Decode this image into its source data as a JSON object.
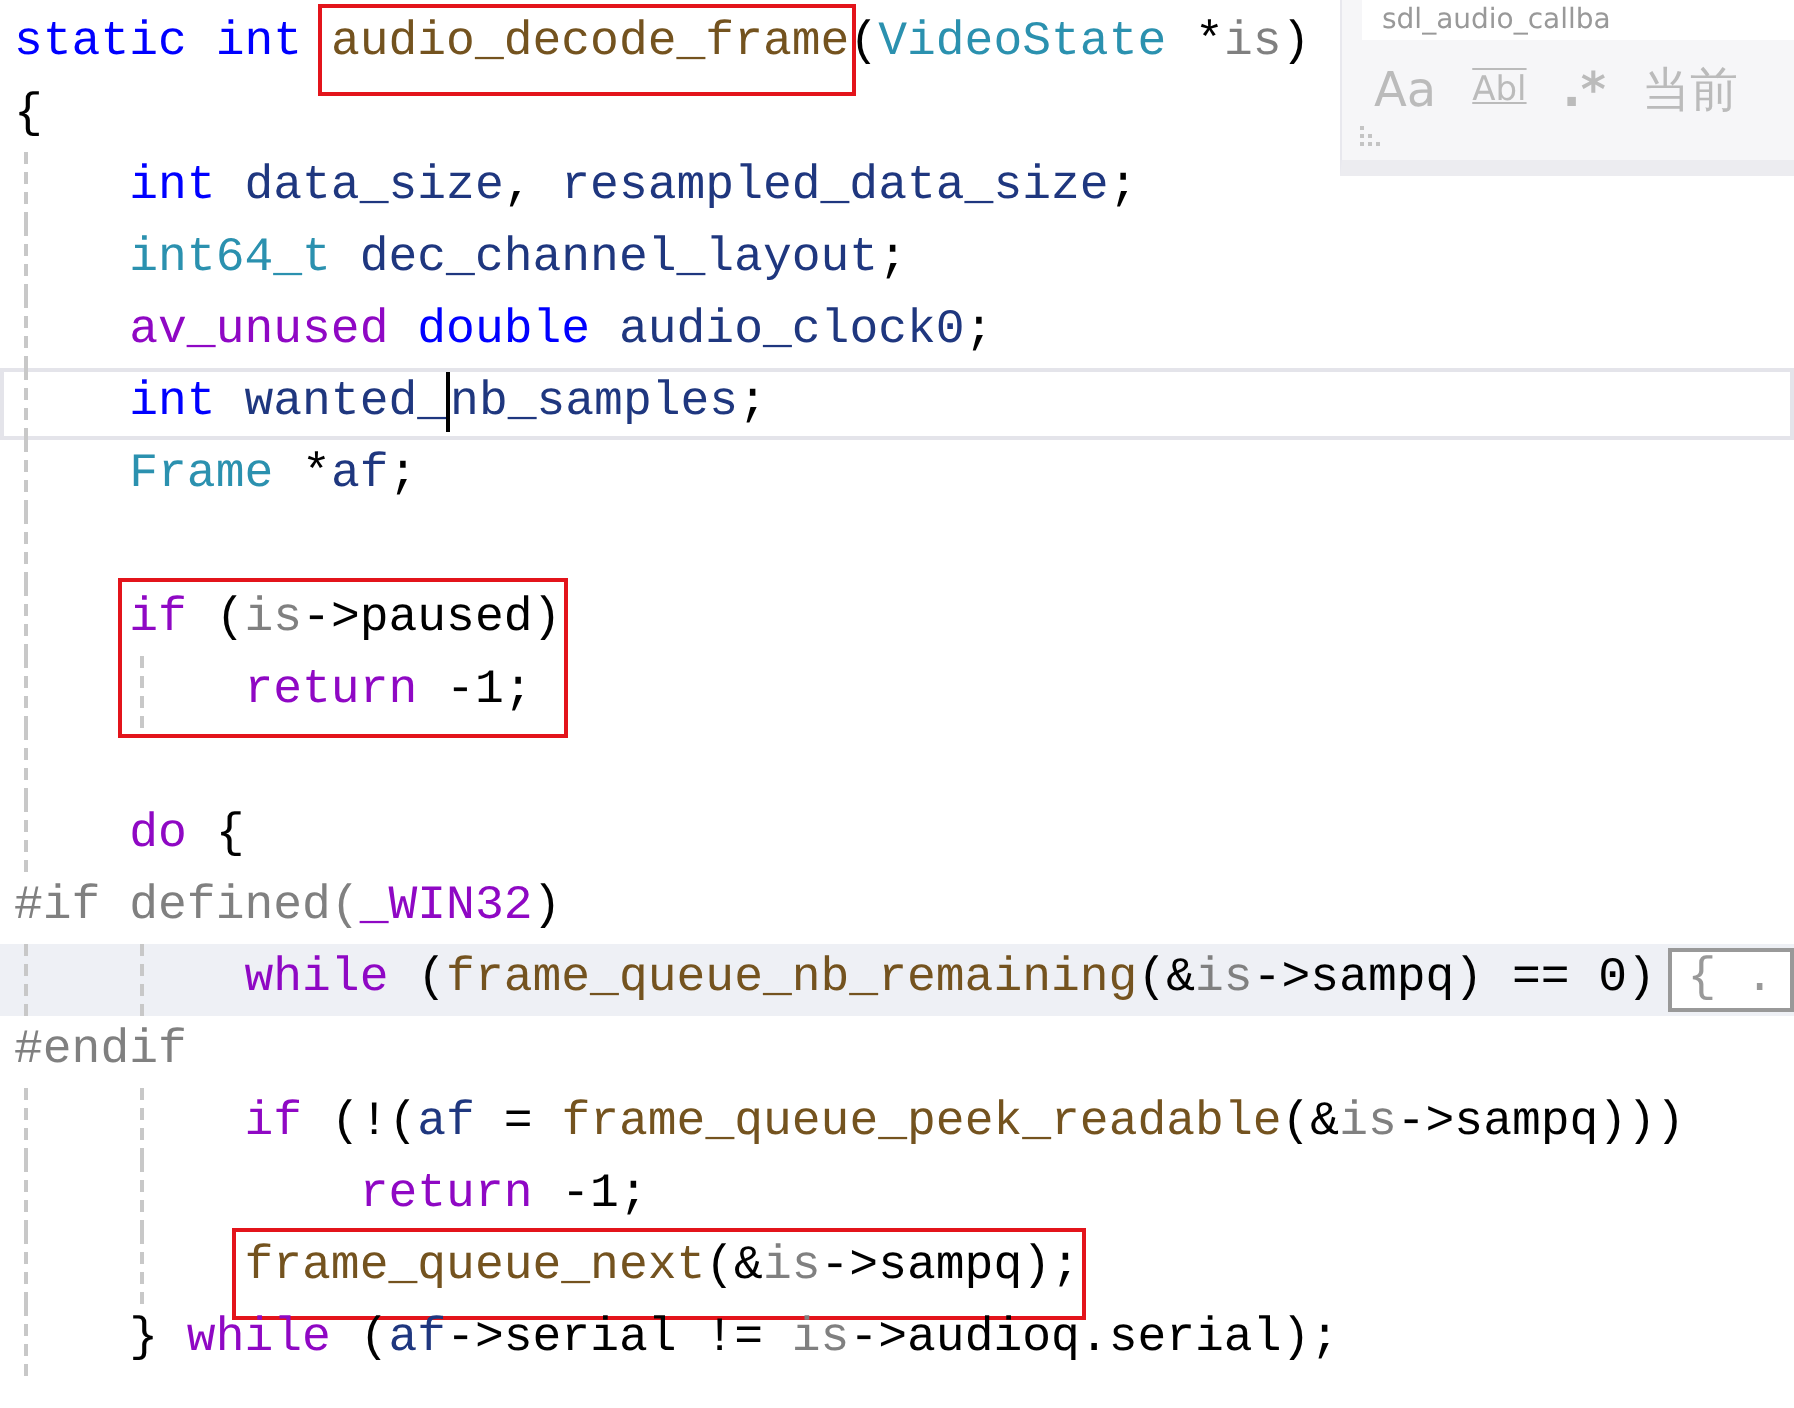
{
  "find_widget": {
    "search_value": "sdl_audio_callba",
    "options": [
      {
        "label": "Aa",
        "kind": "case",
        "selected": false
      },
      {
        "label": "Abl",
        "kind": "word",
        "selected": false
      },
      {
        "label": ".*",
        "kind": "regex",
        "selected": false
      },
      {
        "label": "当前",
        "kind": "scope",
        "selected": false
      }
    ]
  },
  "lines": [
    {
      "current": false,
      "highlighted": false,
      "tokens": [
        {
          "text": "static int ",
          "kind": "keyword"
        },
        {
          "kind": "box",
          "tokens": [
            {
              "text": "audio_decode_frame",
              "kind": "function"
            }
          ]
        },
        {
          "text": "(",
          "kind": "plain"
        },
        {
          "text": "VideoState",
          "kind": "type"
        },
        {
          "text": " *",
          "kind": "plain"
        },
        {
          "text": "is",
          "kind": "param"
        },
        {
          "text": ")",
          "kind": "plain"
        }
      ]
    },
    {
      "current": false,
      "highlighted": false,
      "tokens": [
        {
          "text": "{",
          "kind": "plain"
        }
      ]
    },
    {
      "current": false,
      "highlighted": false,
      "tokens": [
        {
          "text": "    int ",
          "kind": "keyword"
        },
        {
          "text": "data_size",
          "kind": "local"
        },
        {
          "text": ", ",
          "kind": "plain"
        },
        {
          "text": "resampled_data_size",
          "kind": "local"
        },
        {
          "text": ";",
          "kind": "plain"
        }
      ]
    },
    {
      "current": false,
      "highlighted": false,
      "tokens": [
        {
          "text": "    int64_t ",
          "kind": "type"
        },
        {
          "text": "dec_channel_layout",
          "kind": "local"
        },
        {
          "text": ";",
          "kind": "plain"
        }
      ]
    },
    {
      "current": false,
      "highlighted": false,
      "tokens": [
        {
          "text": "    av_unused ",
          "kind": "macro"
        },
        {
          "text": "double ",
          "kind": "keyword"
        },
        {
          "text": "audio_clock0",
          "kind": "local"
        },
        {
          "text": ";",
          "kind": "plain"
        }
      ]
    },
    {
      "current": true,
      "highlighted": false,
      "tokens": [
        {
          "text": "    int ",
          "kind": "keyword"
        },
        {
          "text": "wanted_",
          "kind": "local"
        },
        {
          "kind": "caret"
        },
        {
          "text": "nb_samples",
          "kind": "local"
        },
        {
          "text": ";",
          "kind": "plain"
        }
      ]
    },
    {
      "current": false,
      "highlighted": false,
      "tokens": [
        {
          "text": "    Frame ",
          "kind": "type"
        },
        {
          "text": "*",
          "kind": "plain"
        },
        {
          "text": "af",
          "kind": "local"
        },
        {
          "text": ";",
          "kind": "plain"
        }
      ]
    },
    {
      "current": false,
      "highlighted": false
    },
    {
      "current": false,
      "highlighted": false,
      "tokens": [
        {
          "kind": "box",
          "tokens": [
            {
              "text": "    if ",
              "kind": "control"
            },
            {
              "text": "(",
              "kind": "plain"
            },
            {
              "text": "is",
              "kind": "param"
            },
            {
              "text": "->paused)",
              "kind": "plain"
            }
          ]
        }
      ]
    },
    {
      "current": false,
      "highlighted": false,
      "tokens": [
        {
          "kind": "box",
          "tokens": [
            {
              "text": "        return ",
              "kind": "control"
            },
            {
              "text": "-1;",
              "kind": "plain"
            }
          ]
        }
      ]
    },
    {
      "current": false,
      "highlighted": false
    },
    {
      "current": false,
      "highlighted": false,
      "tokens": [
        {
          "text": "    do ",
          "kind": "control"
        },
        {
          "text": "{",
          "kind": "plain"
        }
      ]
    },
    {
      "current": false,
      "highlighted": false,
      "tokens": [
        {
          "text": "#if defined(",
          "kind": "preproc"
        },
        {
          "text": "_WIN32",
          "kind": "macro"
        },
        {
          "text": ")",
          "kind": "plain"
        }
      ]
    },
    {
      "current": false,
      "highlighted": true,
      "collapsed": "{ .",
      "tokens": [
        {
          "text": "        while ",
          "kind": "control"
        },
        {
          "text": "(",
          "kind": "plain"
        },
        {
          "text": "frame_queue_nb_remaining",
          "kind": "function"
        },
        {
          "text": "(&",
          "kind": "plain"
        },
        {
          "text": "is",
          "kind": "param"
        },
        {
          "text": "->sampq) == 0)",
          "kind": "plain"
        }
      ]
    },
    {
      "current": false,
      "highlighted": false,
      "tokens": [
        {
          "text": "#endif",
          "kind": "preproc"
        }
      ]
    },
    {
      "current": false,
      "highlighted": false,
      "tokens": [
        {
          "text": "        if ",
          "kind": "control"
        },
        {
          "text": "(!(",
          "kind": "plain"
        },
        {
          "text": "af",
          "kind": "local"
        },
        {
          "text": " = ",
          "kind": "plain"
        },
        {
          "text": "frame_queue_peek_readable",
          "kind": "function"
        },
        {
          "text": "(&",
          "kind": "plain"
        },
        {
          "text": "is",
          "kind": "param"
        },
        {
          "text": "->sampq)))",
          "kind": "plain"
        }
      ]
    },
    {
      "current": false,
      "highlighted": false,
      "tokens": [
        {
          "text": "            return ",
          "kind": "control"
        },
        {
          "text": "-1;",
          "kind": "plain"
        }
      ]
    },
    {
      "current": false,
      "highlighted": false,
      "tokens": [
        {
          "kind": "box",
          "tokens": [
            {
              "text": "        frame_queue_next",
              "kind": "function"
            },
            {
              "text": "(&",
              "kind": "plain"
            },
            {
              "text": "is",
              "kind": "param"
            },
            {
              "text": "->sampq);",
              "kind": "plain"
            }
          ]
        }
      ]
    },
    {
      "current": false,
      "highlighted": false,
      "tokens": [
        {
          "text": "    } ",
          "kind": "plain"
        },
        {
          "text": "while ",
          "kind": "control"
        },
        {
          "text": "(",
          "kind": "plain"
        },
        {
          "text": "af",
          "kind": "local"
        },
        {
          "text": "->serial != ",
          "kind": "plain"
        },
        {
          "text": "is",
          "kind": "param"
        },
        {
          "text": "->audioq.serial);",
          "kind": "plain"
        }
      ]
    }
  ]
}
